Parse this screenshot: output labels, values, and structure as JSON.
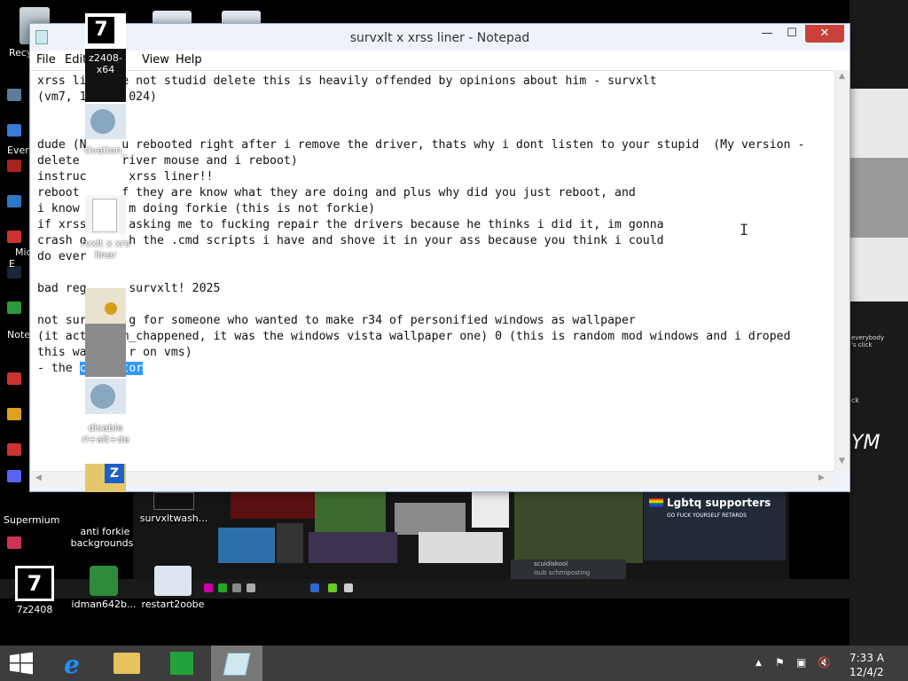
{
  "window": {
    "title": "survxlt x xrss liner - Notepad",
    "minimize": "—",
    "maximize": "☐",
    "close": "✕"
  },
  "menu": {
    "file": "File",
    "edit": "Edit",
    "view": "View",
    "help": "Help"
  },
  "document": {
    "text": "xrss li    he not studid delete this is heavily offended by opinions about him - survxlt\n(vm7, 1      024)\n\n\ndude (N     u rebooted right after i remove the driver, thats why i dont listen to your stupid  (My version -\ndelete      river mouse and i reboot)\ninstruc      xrss liner!!\nreboot      f they are know what they are doing and plus why did you just reboot, and\ni know       m doing forkie (this is not forkie)\nif xrss      asking me to fucking repair the drivers because he thinks i did it, im gonna\ncrash o      h the .cmd scripts i have and shove it in your ass because you think i could\ndo ever\n\nbad reg      survxlt! 2025\n\nnot sur      g for someone who wanted to make r34 of personified windows as wallpaper\n(it act1ab8vm_chappened, it was the windows vista wallpaper one) 0 (this is random mod windows and i droped\nthis wa      r on vms)\n- the ",
    "selected": "c    ator"
  },
  "desktop_icons": {
    "recycle": "Recy",
    "p7z_label": "z2408-x64",
    "activation_label": "tivation_",
    "survxlt_label": "rvxlt x xrs\nliner",
    "disable_label": "disable\nrl+alt+de",
    "z7z2408": "7z2408",
    "idman": "idman642b...",
    "restart": "restart2oobe",
    "antiforkie": "anti forkie\nbackgrounds",
    "survxltwash": "survxltwash...",
    "supermium": "Supermium",
    "every": "Ever",
    "mic": "Mic\nE",
    "note": "Note"
  },
  "wallpaper_text": {
    "lgbtq": "Lgbtq supporters",
    "lgbtq_sub": "GO FUCK YOURSELF RETARDS",
    "everybody": "everybody\n's click",
    "ck": "ck",
    "ym": "YM",
    "chat_name": "scuidiskool",
    "chat_msg": "isub schmiposting"
  },
  "taskbar": {
    "time": "7:33 A",
    "date": "12/4/2"
  },
  "colors": {
    "selection": "#3399ff",
    "close_button": "#c9413a",
    "taskbar": "#3d3d3d"
  }
}
